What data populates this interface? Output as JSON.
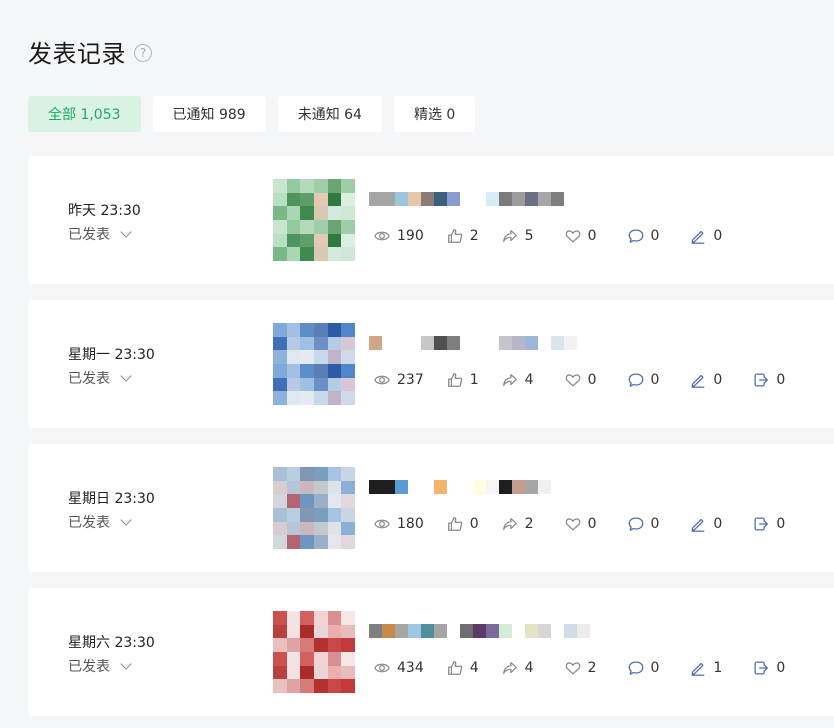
{
  "page": {
    "title": "发表记录",
    "help_icon": "question-circle-icon"
  },
  "tabs": [
    {
      "label": "全部 1,053",
      "active": true
    },
    {
      "label": "已通知 989",
      "active": false
    },
    {
      "label": "未通知 64",
      "active": false
    },
    {
      "label": "精选 0",
      "active": false
    }
  ],
  "colors": {
    "accent": "#1fa866",
    "accent_bg": "#d9f2e4",
    "icon": "#6a7ea8"
  },
  "posts": [
    {
      "date": "昨天 23:30",
      "status": "已发表",
      "stats": {
        "views": "190",
        "likes": "2",
        "shares": "5",
        "favorites": "0",
        "comments": "0",
        "edits": "0"
      },
      "thumb_palette": [
        "#c9e4cf",
        "#a9d6b3",
        "#5e9e6b",
        "#9fcfa8",
        "#d1eadb",
        "#d9efe1",
        "#b9e0c2",
        "#93c99f",
        "#3f8a4f",
        "#e3c7b7",
        "#6aa374",
        "#cfe8d6",
        "#7ab886",
        "#4f9460",
        "#b6d8bd",
        "#d8c8b4",
        "#2f7b3f",
        "#9ecda8"
      ],
      "bar_colors": [
        "#a6a6a6",
        "#a6a6a6",
        "#9ec4e0",
        "#e6c6a8",
        "#8a7b7a",
        "#3c5f7d",
        "#8a9ccf",
        "#ffffff",
        "#ffffff",
        "#d6ecf6",
        "#7b7b7b",
        "#9c9c9c",
        "#6c6f83",
        "#a6a6a6",
        "#7e7e7e"
      ]
    },
    {
      "date": "星期一 23:30",
      "status": "已发表",
      "stats": {
        "views": "237",
        "likes": "1",
        "shares": "4",
        "favorites": "0",
        "comments": "0",
        "edits": "0",
        "exports": "0"
      },
      "thumb_palette": [
        "#c6d9ea",
        "#b3cde6",
        "#4f86c9",
        "#7ea9da",
        "#dfe7f0",
        "#9ec0e3",
        "#5a7fb6",
        "#c0b3c6",
        "#d8c8d6",
        "#3e6fb8",
        "#a3bfe2",
        "#e4e9f3",
        "#6d8fc5",
        "#2c5ca8",
        "#cfd9ea",
        "#8fb2dd",
        "#b7c9e5",
        "#5d8ecc"
      ],
      "bar_colors": [
        "#d0a784",
        "#ffffff",
        "#ffffff",
        "#ffffff",
        "#c6c6c6",
        "#505050",
        "#7e7e7e",
        "#ffffff",
        "#ffffff",
        "#ffffff",
        "#c4c4cc",
        "#b6b6c6",
        "#9fb6db",
        "#ffffff",
        "#d8e6ec",
        "#f2f2f2"
      ]
    },
    {
      "date": "星期日 23:30",
      "status": "已发表",
      "stats": {
        "views": "180",
        "likes": "0",
        "shares": "2",
        "favorites": "0",
        "comments": "0",
        "edits": "0",
        "exports": "0"
      },
      "thumb_palette": [
        "#d3d7dc",
        "#b7c6d6",
        "#7f97b2",
        "#9ab0c8",
        "#dfe3e8",
        "#c7d5e4",
        "#a9bfd6",
        "#b26470",
        "#cbb7bd",
        "#7a9ec0",
        "#e3e7ec",
        "#8bb0d6",
        "#d7ccd2",
        "#b9cde2",
        "#6f96c2",
        "#c4c9cf",
        "#a6c3e3",
        "#e1d8dc"
      ],
      "bar_colors": [
        "#1e1e1e",
        "#1e1e1e",
        "#5a9ad6",
        "#ffffff",
        "#ffffff",
        "#f4b46e",
        "#ffffff",
        "#ffffff",
        "#ffffdd",
        "#f5f5f5",
        "#1e1e1e",
        "#c59d90",
        "#a6a6a6",
        "#f0f0f0"
      ]
    },
    {
      "date": "星期六 23:30",
      "status": "已发表",
      "stats": {
        "views": "434",
        "likes": "4",
        "shares": "4",
        "favorites": "2",
        "comments": "0",
        "edits": "1",
        "exports": "0"
      },
      "thumb_palette": [
        "#e8d6d6",
        "#d98f8f",
        "#c43a3a",
        "#e9c0c0",
        "#f3e2e2",
        "#d26060",
        "#b82f2f",
        "#ecaeae",
        "#f6e7e7",
        "#cc5050",
        "#dea3a3",
        "#ab2a2a",
        "#f1d3d3",
        "#c84848",
        "#e6bcbc",
        "#b94040",
        "#f2e4e4",
        "#d77a7a"
      ],
      "bar_colors": [
        "#7f7f7f",
        "#c68a4a",
        "#a6a6a6",
        "#9ec6e0",
        "#4e8f9c",
        "#a6a6a6",
        "#ffffff",
        "#6e6e6e",
        "#5d3a64",
        "#7a6b9c",
        "#d6ecd6",
        "#ffffff",
        "#e3e3c6",
        "#d6d6d6",
        "#ffffff",
        "#d0dce8",
        "#ececec"
      ]
    }
  ]
}
